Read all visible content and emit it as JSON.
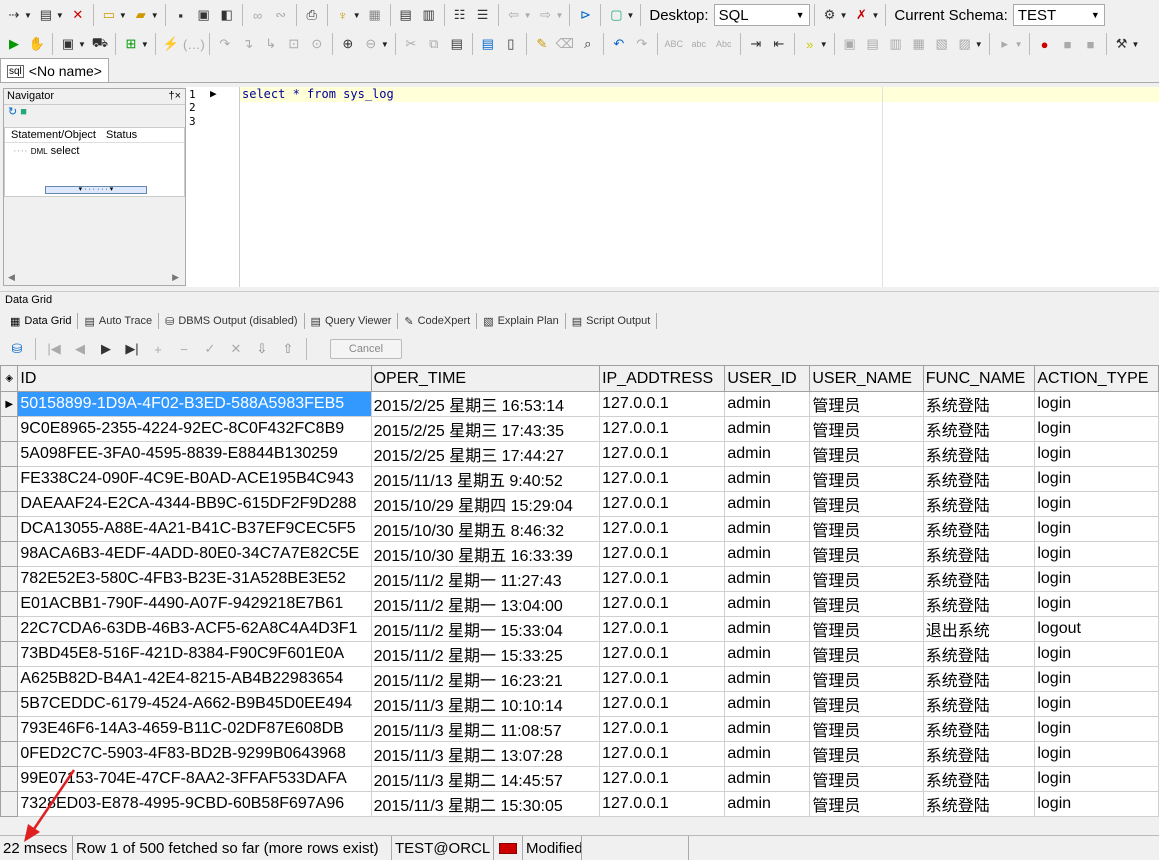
{
  "toolbar1": {
    "desktop_label": "Desktop:",
    "desktop_value": "SQL",
    "schema_label": "Current Schema:",
    "schema_value": "TEST"
  },
  "document_tab": {
    "label": "<No name>"
  },
  "navigator": {
    "title": "Navigator",
    "pin": "†×",
    "col_statement": "Statement/Object",
    "col_status": "Status",
    "rows": [
      {
        "type": "DML",
        "text": "select"
      }
    ]
  },
  "editor": {
    "line_numbers": [
      "1",
      "2",
      "3"
    ],
    "sql": "select * from sys_log"
  },
  "data_grid_title": "Data Grid",
  "output_tabs": [
    {
      "label": "Data Grid",
      "icon": "grid-icon"
    },
    {
      "label": "Auto Trace",
      "icon": "document-icon"
    },
    {
      "label": "DBMS Output (disabled)",
      "icon": "dbms-icon"
    },
    {
      "label": "Query Viewer",
      "icon": "document-icon"
    },
    {
      "label": "CodeXpert",
      "icon": "pencil-icon"
    },
    {
      "label": "Explain Plan",
      "icon": "plan-icon"
    },
    {
      "label": "Script Output",
      "icon": "document-icon"
    }
  ],
  "grid_toolbar": {
    "cancel_label": "Cancel"
  },
  "grid": {
    "columns": [
      "ID",
      "OPER_TIME",
      "IP_ADDTRESS",
      "USER_ID",
      "USER_NAME",
      "FUNC_NAME",
      "ACTION_TYPE"
    ],
    "rows": [
      [
        "50158899-1D9A-4F02-B3ED-588A5983FEB5",
        "2015/2/25 星期三 16:53:14",
        "127.0.0.1",
        "admin",
        "管理员",
        "系统登陆",
        "login"
      ],
      [
        "9C0E8965-2355-4224-92EC-8C0F432FC8B9",
        "2015/2/25 星期三 17:43:35",
        "127.0.0.1",
        "admin",
        "管理员",
        "系统登陆",
        "login"
      ],
      [
        "5A098FEE-3FA0-4595-8839-E8844B130259",
        "2015/2/25 星期三 17:44:27",
        "127.0.0.1",
        "admin",
        "管理员",
        "系统登陆",
        "login"
      ],
      [
        "FE338C24-090F-4C9E-B0AD-ACE195B4C943",
        "2015/11/13 星期五 9:40:52",
        "127.0.0.1",
        "admin",
        "管理员",
        "系统登陆",
        "login"
      ],
      [
        "DAEAAF24-E2CA-4344-BB9C-615DF2F9D288",
        "2015/10/29 星期四 15:29:04",
        "127.0.0.1",
        "admin",
        "管理员",
        "系统登陆",
        "login"
      ],
      [
        "DCA13055-A88E-4A21-B41C-B37EF9CEC5F5",
        "2015/10/30 星期五 8:46:32",
        "127.0.0.1",
        "admin",
        "管理员",
        "系统登陆",
        "login"
      ],
      [
        "98ACA6B3-4EDF-4ADD-80E0-34C7A7E82C5E",
        "2015/10/30 星期五 16:33:39",
        "127.0.0.1",
        "admin",
        "管理员",
        "系统登陆",
        "login"
      ],
      [
        "782E52E3-580C-4FB3-B23E-31A528BE3E52",
        "2015/11/2 星期一 11:27:43",
        "127.0.0.1",
        "admin",
        "管理员",
        "系统登陆",
        "login"
      ],
      [
        "E01ACBB1-790F-4490-A07F-9429218E7B61",
        "2015/11/2 星期一 13:04:00",
        "127.0.0.1",
        "admin",
        "管理员",
        "系统登陆",
        "login"
      ],
      [
        "22C7CDA6-63DB-46B3-ACF5-62A8C4A4D3F1",
        "2015/11/2 星期一 15:33:04",
        "127.0.0.1",
        "admin",
        "管理员",
        "退出系统",
        "logout"
      ],
      [
        "73BD45E8-516F-421D-8384-F90C9F601E0A",
        "2015/11/2 星期一 15:33:25",
        "127.0.0.1",
        "admin",
        "管理员",
        "系统登陆",
        "login"
      ],
      [
        "A625B82D-B4A1-42E4-8215-AB4B22983654",
        "2015/11/2 星期一 16:23:21",
        "127.0.0.1",
        "admin",
        "管理员",
        "系统登陆",
        "login"
      ],
      [
        "5B7CEDDC-6179-4524-A662-B9B45D0EE494",
        "2015/11/3 星期二 10:10:14",
        "127.0.0.1",
        "admin",
        "管理员",
        "系统登陆",
        "login"
      ],
      [
        "793E46F6-14A3-4659-B11C-02DF87E608DB",
        "2015/11/3 星期二 11:08:57",
        "127.0.0.1",
        "admin",
        "管理员",
        "系统登陆",
        "login"
      ],
      [
        "0FED2C7C-5903-4F83-BD2B-9299B0643968",
        "2015/11/3 星期二 13:07:28",
        "127.0.0.1",
        "admin",
        "管理员",
        "系统登陆",
        "login"
      ],
      [
        "99E07153-704E-47CF-8AA2-3FFAF533DAFA",
        "2015/11/3 星期二 14:45:57",
        "127.0.0.1",
        "admin",
        "管理员",
        "系统登陆",
        "login"
      ],
      [
        "7328ED03-E878-4995-9CBD-60B58F697A96",
        "2015/11/3 星期二 15:30:05",
        "127.0.0.1",
        "admin",
        "管理员",
        "系统登陆",
        "login"
      ]
    ]
  },
  "status_bar": {
    "time": "22 msecs",
    "fetch": "Row 1 of 500 fetched so far (more rows exist)",
    "connection": "TEST@ORCL",
    "state": "Modified"
  },
  "colors": {
    "selection": "#3399ff",
    "current_line": "#ffffd8",
    "sql_text": "#000099",
    "annotation_arrow": "#e02020"
  }
}
